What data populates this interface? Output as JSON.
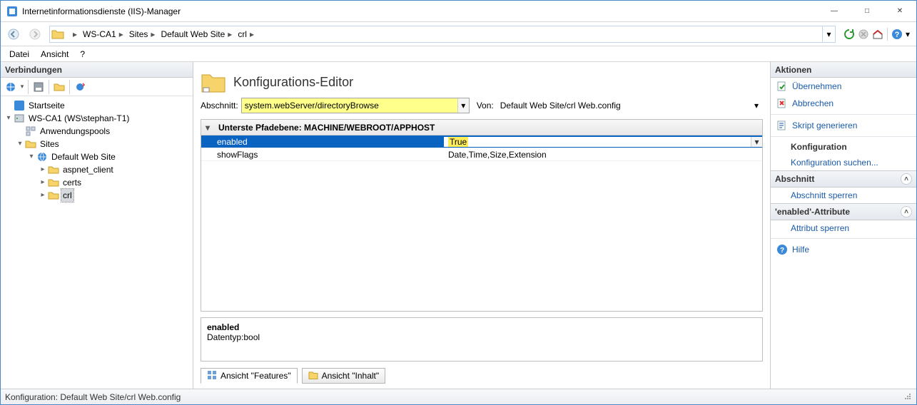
{
  "window": {
    "title": "Internetinformationsdienste (IIS)-Manager"
  },
  "breadcrumb": {
    "items": [
      "WS-CA1",
      "Sites",
      "Default Web Site",
      "crl"
    ]
  },
  "menu": {
    "items": [
      "Datei",
      "Ansicht",
      "?"
    ]
  },
  "left": {
    "title": "Verbindungen",
    "tree": {
      "startpage": "Startseite",
      "server": "WS-CA1 (WS\\stephan-T1)",
      "apppools": "Anwendungspools",
      "sites": "Sites",
      "default_site": "Default Web Site",
      "aspnet_client": "aspnet_client",
      "certs": "certs",
      "crl": "crl"
    }
  },
  "center": {
    "heading": "Konfigurations-Editor",
    "section_label": "Abschnitt:",
    "section_value": "system.webServer/directoryBrowse",
    "from_label": "Von:",
    "from_value": "Default Web Site/crl Web.config",
    "grid": {
      "group_header": "Unterste Pfadebene: MACHINE/WEBROOT/APPHOST",
      "rows": [
        {
          "name": "enabled",
          "value": "True",
          "selected": true,
          "highlight_value": true
        },
        {
          "name": "showFlags",
          "value": "Date,Time,Size,Extension",
          "selected": false,
          "highlight_value": false
        }
      ]
    },
    "detail": {
      "name": "enabled",
      "type_line": "Datentyp:bool"
    },
    "tabs": {
      "features": "Ansicht \"Features\"",
      "content": "Ansicht \"Inhalt\""
    }
  },
  "right": {
    "title": "Aktionen",
    "apply": "Übernehmen",
    "cancel": "Abbrechen",
    "script": "Skript generieren",
    "config_hdr": "Konfiguration",
    "config_search": "Konfiguration suchen...",
    "section_hdr": "Abschnitt",
    "section_lock": "Abschnitt sperren",
    "attr_hdr": "'enabled'-Attribute",
    "attr_lock": "Attribut sperren",
    "help": "Hilfe"
  },
  "status": {
    "text": "Konfiguration: Default Web Site/crl Web.config"
  }
}
